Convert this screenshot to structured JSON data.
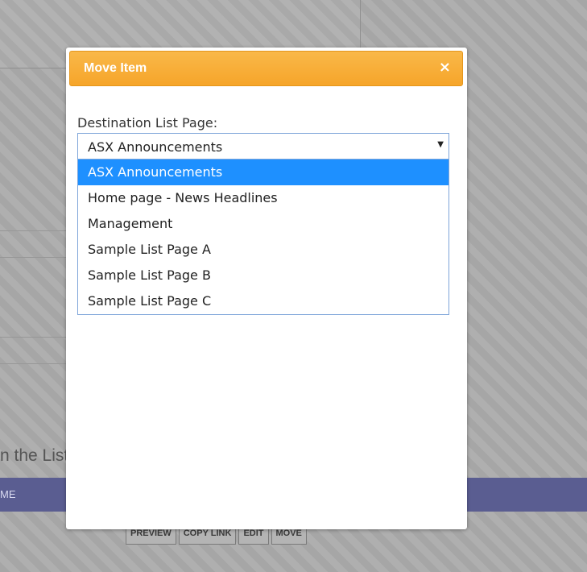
{
  "background": {
    "partial_text": "n the List",
    "bar_label": "ME",
    "actions": [
      "PREVIEW",
      "COPY LINK",
      "EDIT",
      "MOVE"
    ]
  },
  "modal": {
    "title": "Move Item",
    "close_icon": "×",
    "field_label": "Destination List Page:",
    "selected_value": "ASX Announcements",
    "options": [
      "ASX Announcements",
      "Home page - News Headlines",
      "Management",
      "Sample List Page A",
      "Sample List Page B",
      "Sample List Page C"
    ],
    "highlighted_index": 0
  },
  "colors": {
    "header_orange": "#f6a52a",
    "highlight_blue": "#1e90ff",
    "bar_purple": "#5a5d91"
  }
}
